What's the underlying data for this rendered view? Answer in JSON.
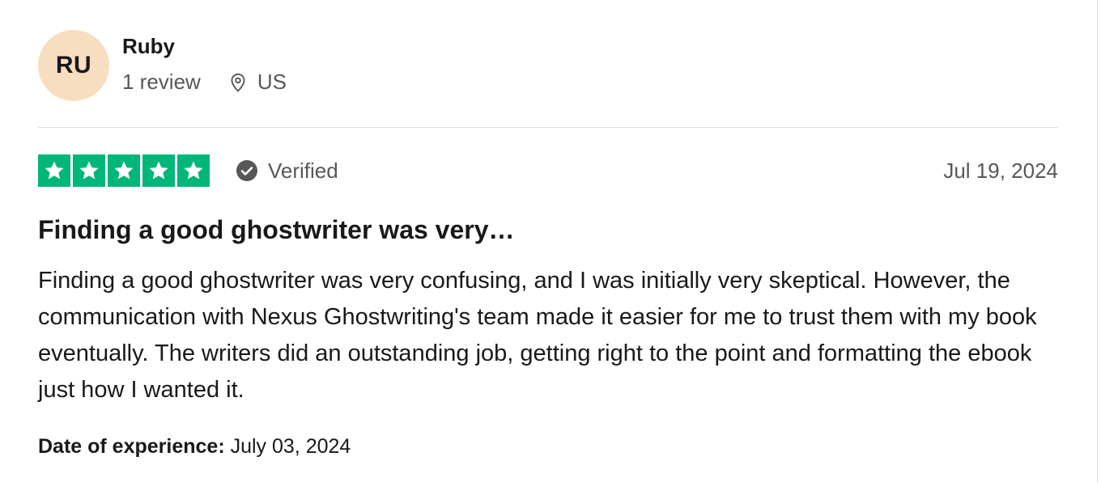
{
  "reviewer": {
    "initials": "RU",
    "name": "Ruby",
    "review_count": "1 review",
    "country": "US"
  },
  "rating": {
    "stars": 5,
    "max_stars": 5,
    "star_color": "#00b67a",
    "verified_label": "Verified",
    "date": "Jul 19, 2024"
  },
  "review": {
    "title": "Finding a good ghostwriter was very…",
    "body": "Finding a good ghostwriter was very confusing, and I was initially very skeptical. However, the communication with Nexus Ghostwriting's team made it easier for me to trust them with my book eventually. The writers did an outstanding job, getting right to the point and formatting the ebook just how I wanted it."
  },
  "experience": {
    "label": "Date of experience:",
    "value": "July 03, 2024"
  },
  "icons": {
    "location": "location-pin-icon",
    "verified": "check-circle-icon",
    "star": "star-icon"
  },
  "colors": {
    "avatar_bg": "#f8dec1",
    "muted_text": "#575757",
    "text": "#191919"
  }
}
